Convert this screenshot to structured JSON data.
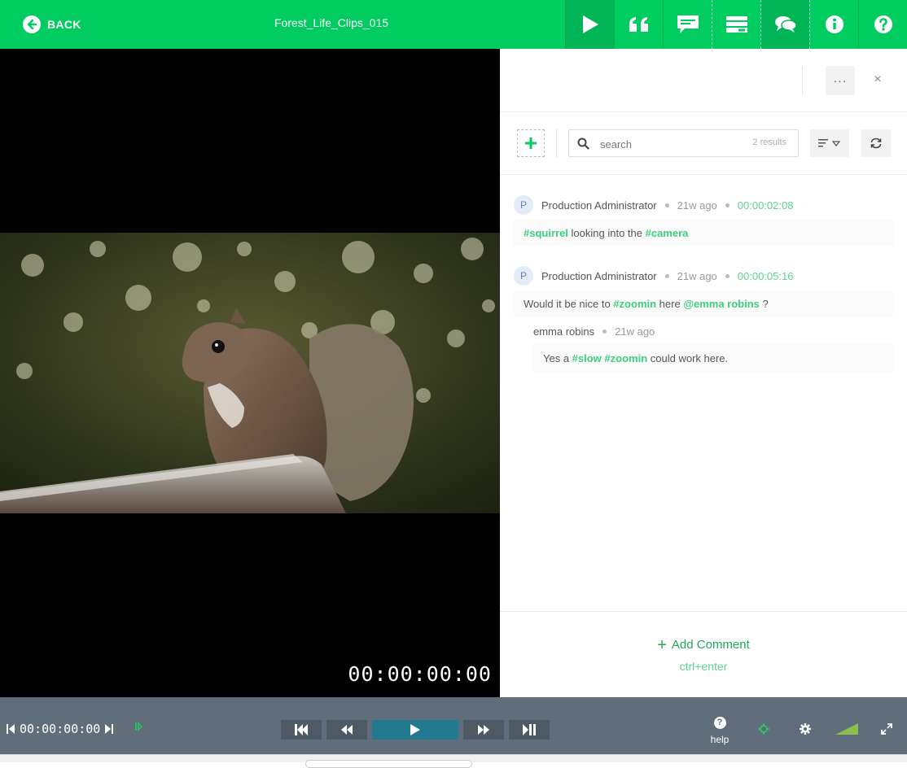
{
  "topbar": {
    "back_label": "BACK",
    "title": "Forest_Life_Clips_015",
    "buttons": [
      "play-icon",
      "quote-icon",
      "subtitle-icon",
      "layout-icon",
      "comments-icon",
      "info-icon",
      "help-icon"
    ]
  },
  "video": {
    "timecode": "00:00:00:00"
  },
  "panel": {
    "more_label": "···",
    "close_label": "×",
    "search": {
      "placeholder": "search",
      "results": "2 results"
    },
    "comments": [
      {
        "avatar": "P",
        "author": "Production Administrator",
        "time_ago": "21w ago",
        "timecode": "00:00:02:08",
        "body": {
          "tag1": "#squirrel",
          "text1": " looking into the ",
          "tag2": "#camera"
        }
      },
      {
        "avatar": "P",
        "author": "Production Administrator",
        "time_ago": "21w ago",
        "timecode": "00:00:05:16",
        "body": {
          "text1": "Would it be nice to ",
          "tag1": "#zoomin",
          "text2": " here ",
          "mention": "@emma robins",
          "text3": " ?"
        },
        "reply": {
          "author": "emma robins",
          "time_ago": "21w ago",
          "body": {
            "text1": "Yes a ",
            "tag1": "#slow",
            "tag2": "#zoomin",
            "text2": " could work here."
          }
        }
      }
    ],
    "add_comment": "Add Comment",
    "shortcut": "ctrl+enter"
  },
  "player": {
    "timecode": "00:00:00:00",
    "help_label": "help",
    "help_glyph": "?",
    "accent": "#00cc5f",
    "play_color": "#217a8f"
  }
}
